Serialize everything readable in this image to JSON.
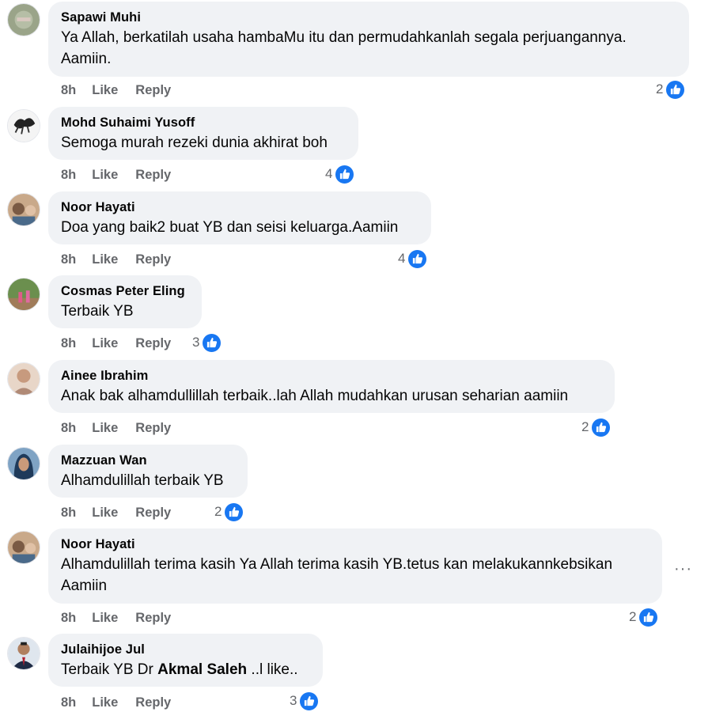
{
  "actions": {
    "like": "Like",
    "reply": "Reply"
  },
  "reaction_icon": "thumbs-up-icon",
  "colors": {
    "like_blue": "#1877f2",
    "bubble_bg": "#f0f2f5",
    "meta_gray": "#65676b"
  },
  "more_menu": "···",
  "comments": [
    {
      "author": "Sapawi Muhi",
      "text": "Ya Allah, berkatilah usaha hambaMu itu dan permudahkanlah segala perjuangannya.",
      "text2": "Aamiin.",
      "time": "8h",
      "reactions": "2"
    },
    {
      "author": "Mohd Suhaimi Yusoff",
      "text": "Semoga murah rezeki dunia akhirat boh",
      "time": "8h",
      "reactions": "4"
    },
    {
      "author": "Noor Hayati",
      "text": "Doa yang baik2 buat YB dan seisi keluarga.Aamiin",
      "time": "8h",
      "reactions": "4"
    },
    {
      "author": "Cosmas Peter Eling",
      "text": "Terbaik YB",
      "time": "8h",
      "reactions": "3"
    },
    {
      "author": "Ainee Ibrahim",
      "text": "Anak bak alhamdullillah terbaik..lah Allah mudahkan urusan seharian aamiin",
      "time": "8h",
      "reactions": "2"
    },
    {
      "author": "Mazzuan Wan",
      "text": "Alhamdulillah terbaik YB",
      "time": "8h",
      "reactions": "2"
    },
    {
      "author": "Noor Hayati",
      "text": "Alhamdulillah terima kasih Ya Allah terima kasih YB.tetus kan melakukannkebsikan",
      "text2": "Aamiin",
      "time": "8h",
      "reactions": "2"
    },
    {
      "author": "Julaihijoe Jul",
      "text_pre": "Terbaik YB Dr ",
      "text_bold": "Akmal Saleh",
      "text_post": " ..l like..",
      "time": "8h",
      "reactions": "3"
    }
  ]
}
